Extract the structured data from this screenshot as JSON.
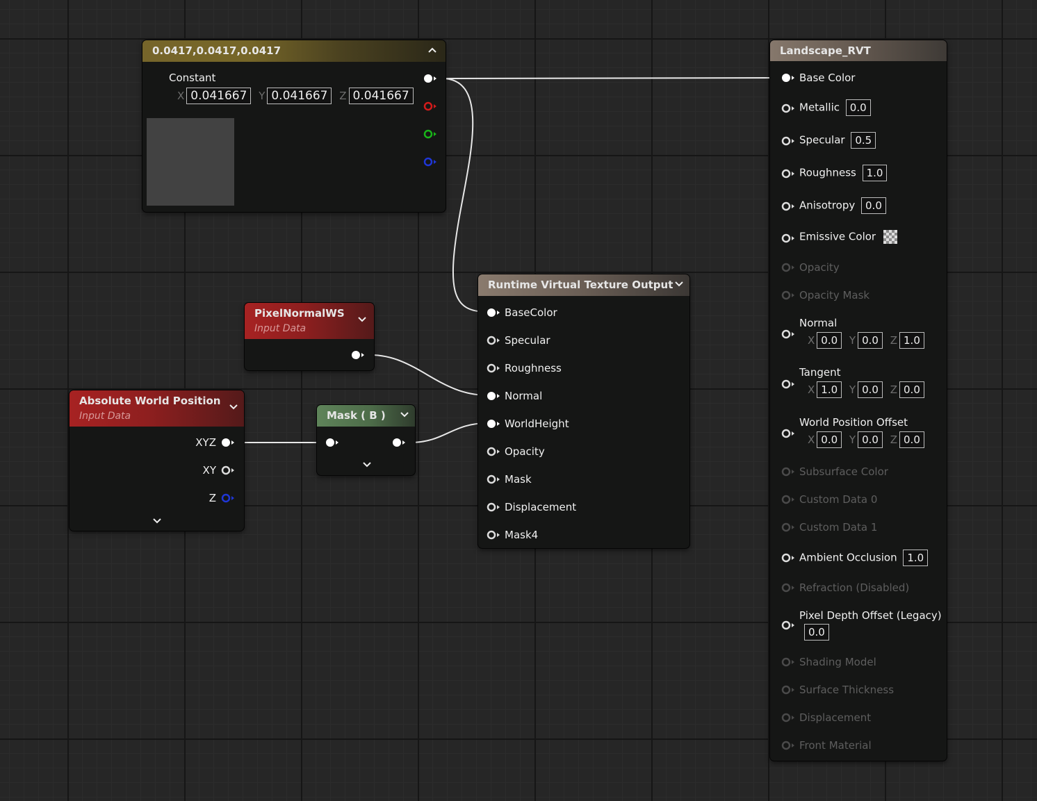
{
  "constant_node": {
    "title": "0.0417,0.0417,0.0417",
    "label": "Constant",
    "x_axis": "X",
    "x_value": "0.041667",
    "y_axis": "Y",
    "y_value": "0.041667",
    "z_axis": "Z",
    "z_value": "0.041667",
    "preview_color": "#424242"
  },
  "pixel_normal_node": {
    "title": "PixelNormalWS",
    "subtitle": "Input Data"
  },
  "absolute_world_position_node": {
    "title": "Absolute World Position",
    "subtitle": "Input Data",
    "outputs": [
      "XYZ",
      "XY",
      "Z"
    ]
  },
  "mask_node": {
    "title": "Mask ( B )"
  },
  "rvt_output_node": {
    "title": "Runtime Virtual Texture Output",
    "inputs": [
      "BaseColor",
      "Specular",
      "Roughness",
      "Normal",
      "WorldHeight",
      "Opacity",
      "Mask",
      "Displacement",
      "Mask4"
    ]
  },
  "material_node": {
    "title": "Landscape_RVT",
    "base_color": "Base Color",
    "metallic": "Metallic",
    "metallic_value": "0.0",
    "specular": "Specular",
    "specular_value": "0.5",
    "roughness": "Roughness",
    "roughness_value": "1.0",
    "anisotropy": "Anisotropy",
    "anisotropy_value": "0.0",
    "emissive": "Emissive Color",
    "opacity": "Opacity",
    "opacity_mask": "Opacity Mask",
    "normal": "Normal",
    "normal_x": "0.0",
    "normal_y": "0.0",
    "normal_z": "1.0",
    "tangent": "Tangent",
    "tangent_x": "1.0",
    "tangent_y": "0.0",
    "tangent_z": "0.0",
    "wpo": "World Position Offset",
    "wpo_x": "0.0",
    "wpo_y": "0.0",
    "wpo_z": "0.0",
    "subsurface": "Subsurface Color",
    "custom0": "Custom Data 0",
    "custom1": "Custom Data 1",
    "ao": "Ambient Occlusion",
    "ao_value": "1.0",
    "refraction": "Refraction (Disabled)",
    "pdo": "Pixel Depth Offset (Legacy)",
    "pdo_value": "0.0",
    "shading_model": "Shading Model",
    "surface_thickness": "Surface Thickness",
    "displacement": "Displacement",
    "front_material": "Front Material",
    "axis_x": "X",
    "axis_y": "Y",
    "axis_z": "Z"
  },
  "colors": {
    "wire": "#e8e8e8",
    "pin_red": "#d21b1b",
    "pin_green": "#19b419",
    "pin_blue": "#1f36d6"
  }
}
